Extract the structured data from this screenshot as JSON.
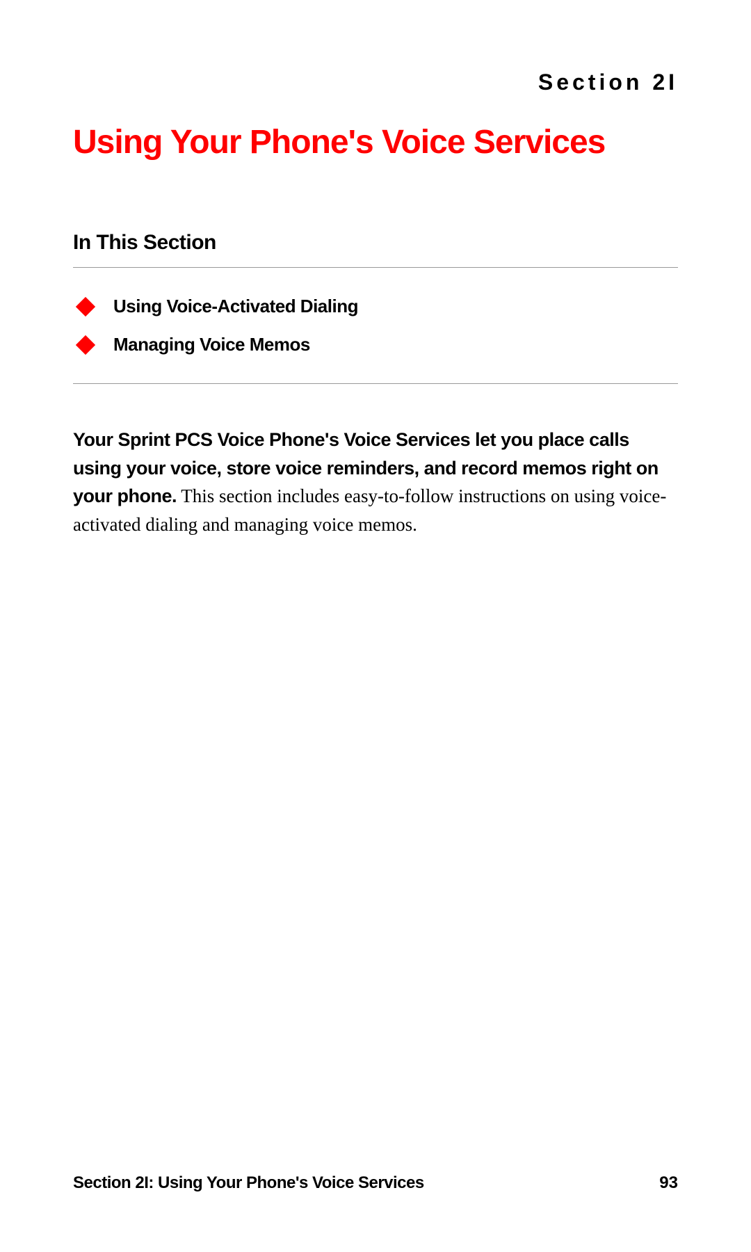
{
  "header": {
    "section_label": "Section 2I"
  },
  "title": "Using Your Phone's Voice Services",
  "subsection": {
    "heading": "In This Section",
    "items": [
      "Using Voice-Activated Dialing",
      "Managing Voice Memos"
    ]
  },
  "body": {
    "bold_intro": "Your Sprint PCS Voice Phone's Voice Services let you place calls using your voice, store voice reminders, and record memos right on your phone.",
    "regular": "This section includes easy-to-follow instructions on using voice-activated dialing and managing voice memos."
  },
  "footer": {
    "left": "Section 2I: Using Your Phone's Voice Services",
    "page_number": "93"
  }
}
